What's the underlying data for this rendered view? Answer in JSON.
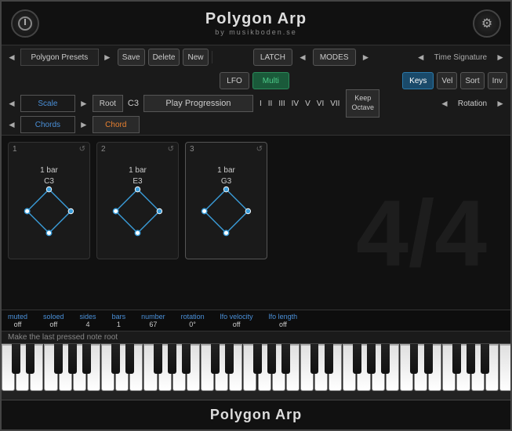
{
  "app": {
    "title": "Polygon Arp",
    "subtitle": "by musikboden.se",
    "bottom_title": "Polygon Arp"
  },
  "header": {
    "power_icon": "⏻",
    "gear_icon": "⚙"
  },
  "toolbar": {
    "preset_label": "Polygon Presets",
    "save_label": "Save",
    "delete_label": "Delete",
    "new_label": "New",
    "latch_label": "LATCH",
    "modes_label": "MODES",
    "time_signature_label": "Time Signature",
    "lfo_label": "LFO",
    "multi_label": "Multi",
    "keys_label": "Keys",
    "vel_label": "Vel",
    "sort_label": "Sort",
    "inv_label": "Inv"
  },
  "scale_row": {
    "scale_label": "Scale",
    "root_label": "Root",
    "note": "C3",
    "play_progression": "Play Progression",
    "keep_octave": "Keep\nOctave",
    "rotation_label": "Rotation",
    "numerals": [
      "I",
      "II",
      "III",
      "IV",
      "V",
      "VI",
      "VII"
    ]
  },
  "chords_row": {
    "chords_label": "Chords",
    "chord_label": "Chord"
  },
  "chord_cards": [
    {
      "num": "1",
      "bar": "1 bar",
      "note": "C3",
      "active": false
    },
    {
      "num": "2",
      "bar": "1 bar",
      "note": "E3",
      "active": false
    },
    {
      "num": "3",
      "bar": "1 bar",
      "note": "G3",
      "active": true
    }
  ],
  "time_display": "4/4",
  "status": {
    "items": [
      {
        "label": "muted",
        "value": "off"
      },
      {
        "label": "soloed",
        "value": "off"
      },
      {
        "label": "sides",
        "value": "4"
      },
      {
        "label": "bars",
        "value": "1"
      },
      {
        "label": "number",
        "value": "67"
      },
      {
        "label": "rotation",
        "value": "0°"
      },
      {
        "label": "lfo velocity",
        "value": "off"
      },
      {
        "label": "lfo length",
        "value": "off"
      }
    ],
    "message": "Make the last pressed note root"
  },
  "keyboard": {
    "white_keys": 36,
    "active_keys": []
  }
}
